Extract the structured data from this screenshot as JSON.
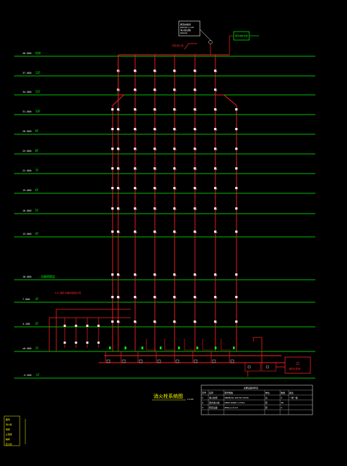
{
  "drawing": {
    "title": "消火栓系统图",
    "scale": "1:100",
    "section_note": "A-A  消防水箱间剖面示意",
    "room_label": "消防水泵房",
    "tank_label": "屋顶消防水箱",
    "roof_note": "试验消火栓"
  },
  "floors": [
    {
      "label": "机房",
      "elev": "40.800"
    },
    {
      "label": "12F",
      "elev": "37.800"
    },
    {
      "label": "11F",
      "elev": "34.800"
    },
    {
      "label": "10F",
      "elev": "31.800"
    },
    {
      "label": "9F",
      "elev": "28.800"
    },
    {
      "label": "8F",
      "elev": "25.800"
    },
    {
      "label": "7F",
      "elev": "22.800"
    },
    {
      "label": "6F",
      "elev": "19.800"
    },
    {
      "label": "5F",
      "elev": "16.800"
    },
    {
      "label": "4F",
      "elev": "13.800"
    },
    {
      "label": "设备转换层",
      "elev": "10.800"
    },
    {
      "label": "3F",
      "elev": "7.800"
    },
    {
      "label": "2F",
      "elev": "4.200"
    },
    {
      "label": "1F",
      "elev": "±0.000"
    },
    {
      "label": "-1F",
      "elev": "-4.500"
    }
  ],
  "risers": [
    "XL-1",
    "XL-2",
    "XL-3",
    "XL-4",
    "XL-5",
    "XL-6"
  ],
  "callout": [
    "屋顶水箱间",
    "DN150  L=18",
    "消火栓试验",
    "DN100"
  ],
  "legend_table": {
    "title": "主要设备材料表",
    "headers": [
      "序号",
      "名称",
      "型号规格",
      "单位",
      "数量",
      "备注"
    ],
    "rows": [
      [
        "1",
        "消火栓泵",
        "XBD8/30-100  N=37kW",
        "台",
        "2",
        "一用一备"
      ],
      [
        "2",
        "室内消火栓",
        "SN65  DN65  L=25m",
        "套",
        "96",
        ""
      ],
      [
        "3",
        "稳压设备",
        "ZW(L)-I-X-10",
        "套",
        "1",
        ""
      ]
    ]
  },
  "side_legend": [
    "图例",
    "消火栓",
    "闸阀",
    "止回阀",
    "蝶阀",
    "压力表"
  ],
  "colors": {
    "floor_line": "#00ff00",
    "pipe": "#ff2020",
    "text": "#ffffff",
    "title": "#ffff00"
  }
}
